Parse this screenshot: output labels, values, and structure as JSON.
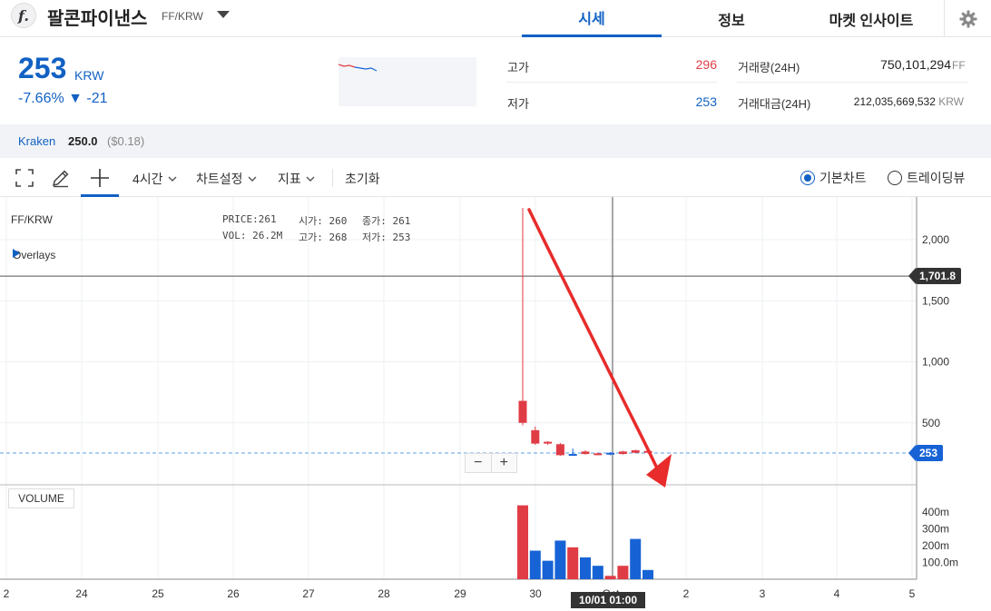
{
  "header": {
    "coin_name": "팔콘파이낸스",
    "pair": "FF/KRW",
    "logo_letter": "f.",
    "tabs": [
      {
        "label": "시세",
        "active": true
      },
      {
        "label": "정보",
        "active": false
      },
      {
        "label": "마켓 인사이트",
        "active": false
      }
    ],
    "settings_icon": "gear-icon"
  },
  "summary": {
    "price": "253",
    "unit": "KRW",
    "change": "-7.66% ▼ -21",
    "high_label": "고가",
    "high_value": "296",
    "low_label": "저가",
    "low_value": "253",
    "volume_label": "거래량(24H)",
    "volume_value": "750,101,294",
    "volume_unit": "FF",
    "amount_label": "거래대금(24H)",
    "amount_value": "212,035,669,532",
    "amount_unit": "KRW"
  },
  "exchange": {
    "name": "Kraken",
    "price": "250.0",
    "usd": "($0.18)"
  },
  "toolbar": {
    "interval": "4시간",
    "chart_settings": "차트설정",
    "indicators": "지표",
    "reset": "초기화",
    "basic_chart": "기본차트",
    "trading_view": "트레이딩뷰",
    "selected_view": "기본차트"
  },
  "chart": {
    "pair_label": "FF/KRW",
    "overlays_label": "Overlays",
    "ohlc": {
      "price_label": "PRICE:",
      "price": "261",
      "open_label": "시가:",
      "open": "260",
      "close_label": "종가:",
      "close": "261",
      "vol_label": "VOL:",
      "vol": "26.2M",
      "high_label": "고가:",
      "high": "268",
      "low_label": "저가:",
      "low": "253"
    },
    "volume_label": "VOLUME",
    "crosshair_price": "1,701.8",
    "current_price_tag": "253",
    "crosshair_time": "10/01 01:00",
    "zoom_out": "−",
    "zoom_in": "+",
    "colors": {
      "up": "#e03c46",
      "down": "#1763d6",
      "accent": "#1261c4",
      "annotation": "#e82b2b"
    }
  },
  "chart_data": {
    "type": "candlestick",
    "title": "",
    "x_ticks": [
      "2",
      "24",
      "25",
      "26",
      "27",
      "28",
      "29",
      "30",
      "Oct",
      "2",
      "3",
      "4",
      "5"
    ],
    "y_ticks": [
      "500",
      "1,000",
      "1,500",
      "2,000"
    ],
    "ylim": [
      0,
      2400
    ],
    "volume_ticks": [
      "100.0m",
      "200m",
      "300m",
      "400m"
    ],
    "volume_ylim": [
      0,
      480
    ],
    "candles": [
      {
        "time": "09/29 21:00",
        "open": 500,
        "close": 680,
        "high": 2260,
        "low": 480
      },
      {
        "time": "09/30 01:00",
        "open": 330,
        "close": 440,
        "high": 470,
        "low": 320
      },
      {
        "time": "09/30 05:00",
        "open": 330,
        "close": 345,
        "high": 350,
        "low": 320
      },
      {
        "time": "09/30 09:00",
        "open": 235,
        "close": 325,
        "high": 335,
        "low": 230
      },
      {
        "time": "09/30 13:00",
        "open": 245,
        "close": 240,
        "high": 290,
        "low": 240
      },
      {
        "time": "09/30 17:00",
        "open": 245,
        "close": 265,
        "high": 275,
        "low": 240
      },
      {
        "time": "09/30 21:00",
        "open": 240,
        "close": 250,
        "high": 255,
        "low": 235
      },
      {
        "time": "10/01 01:00",
        "open": 255,
        "close": 240,
        "high": 260,
        "low": 235
      },
      {
        "time": "10/01 05:00",
        "open": 245,
        "close": 265,
        "high": 270,
        "low": 240
      },
      {
        "time": "10/01 09:00",
        "open": 255,
        "close": 275,
        "high": 280,
        "low": 250
      },
      {
        "time": "10/01 13:00",
        "open": 262,
        "close": 270,
        "high": 272,
        "low": 250
      }
    ],
    "volumes": [
      {
        "value": 440,
        "dir": "up"
      },
      {
        "value": 170,
        "dir": "down"
      },
      {
        "value": 110,
        "dir": "down"
      },
      {
        "value": 230,
        "dir": "down"
      },
      {
        "value": 190,
        "dir": "up"
      },
      {
        "value": 130,
        "dir": "down"
      },
      {
        "value": 80,
        "dir": "down"
      },
      {
        "value": 20,
        "dir": "up"
      },
      {
        "value": 80,
        "dir": "up"
      },
      {
        "value": 240,
        "dir": "down"
      },
      {
        "value": 55,
        "dir": "down"
      }
    ],
    "crosshair": {
      "y": 1701.8
    },
    "current_price": 253
  }
}
